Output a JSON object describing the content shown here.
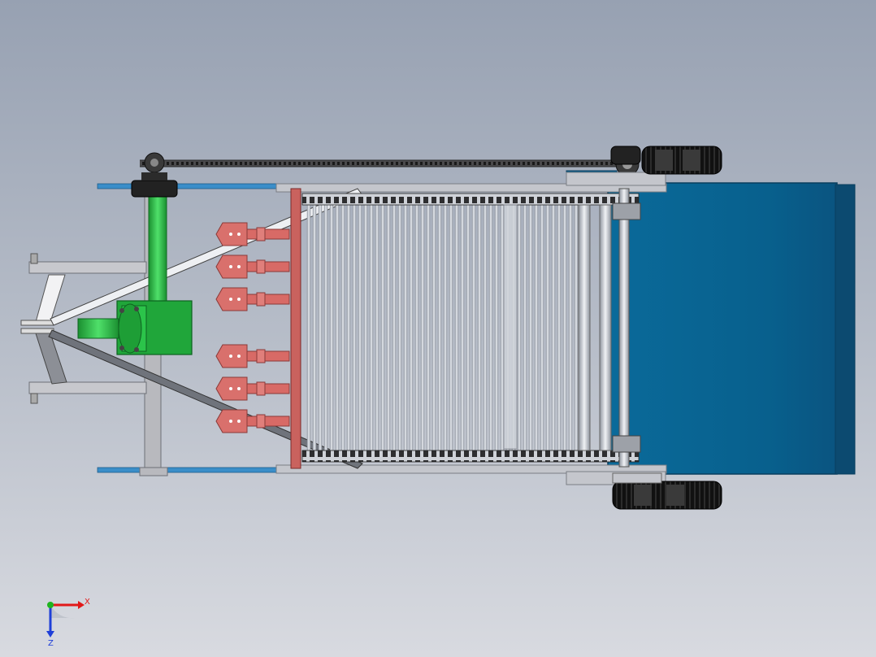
{
  "app": {
    "view": "graphics-area"
  },
  "model": {
    "colors": {
      "background_top": "#97a1b2",
      "background_bottom": "#d8dae0",
      "hopper": "#0a5f8c",
      "hopper_dark": "#0b4f77",
      "gearbox": "#1fa83a",
      "gearbox_light": "#35d052",
      "blades": "#d9706c",
      "frame": "#b8b8bc",
      "conveyor_rods": "#c8ccd4",
      "chain": "#3a3a3a",
      "tires": "#111111"
    }
  },
  "triad": {
    "x_label": "X",
    "z_label": "Z",
    "x_color": "#e11919",
    "y_color": "#1fb41f",
    "z_color": "#1f3fd8"
  }
}
